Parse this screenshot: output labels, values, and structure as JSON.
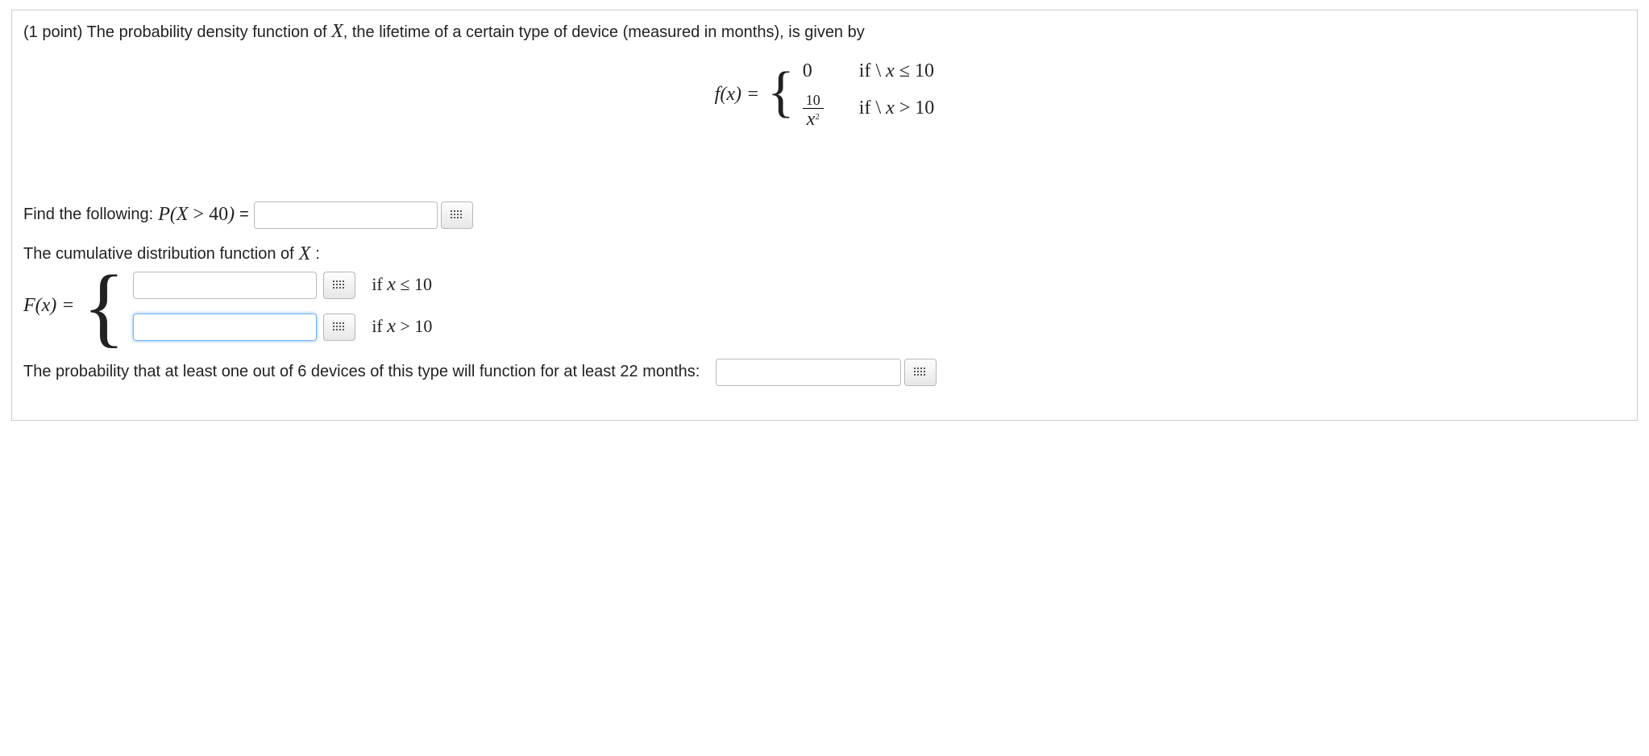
{
  "intro": {
    "points_prefix": "(1 point) ",
    "text_before_X": "The probability density function of ",
    "X": "X",
    "text_after_X": ", the lifetime of a certain type of device (measured in months), is given by"
  },
  "pdf": {
    "lhs": "f(x) = ",
    "case1_value": "0",
    "case1_cond": "if \\ x ≤ 10",
    "case2_num": "10",
    "case2_den_base": "x",
    "case2_den_exp": "2",
    "case2_cond": "if \\ x > 10"
  },
  "q1": {
    "label_before": "Find the following: ",
    "expr": "P(X > 40)",
    "equals": " = ",
    "value": ""
  },
  "cdf": {
    "heading_before": "The cumulative distribution function of ",
    "X": "X",
    "heading_after": ":",
    "lhs": "F(x) = ",
    "row1_value": "",
    "row1_cond": "if x ≤ 10",
    "row2_value": "",
    "row2_cond": "if x > 10"
  },
  "q3": {
    "text": "The probability that at least one out of 6 devices of this type will function for at least 22 months:",
    "value": ""
  }
}
